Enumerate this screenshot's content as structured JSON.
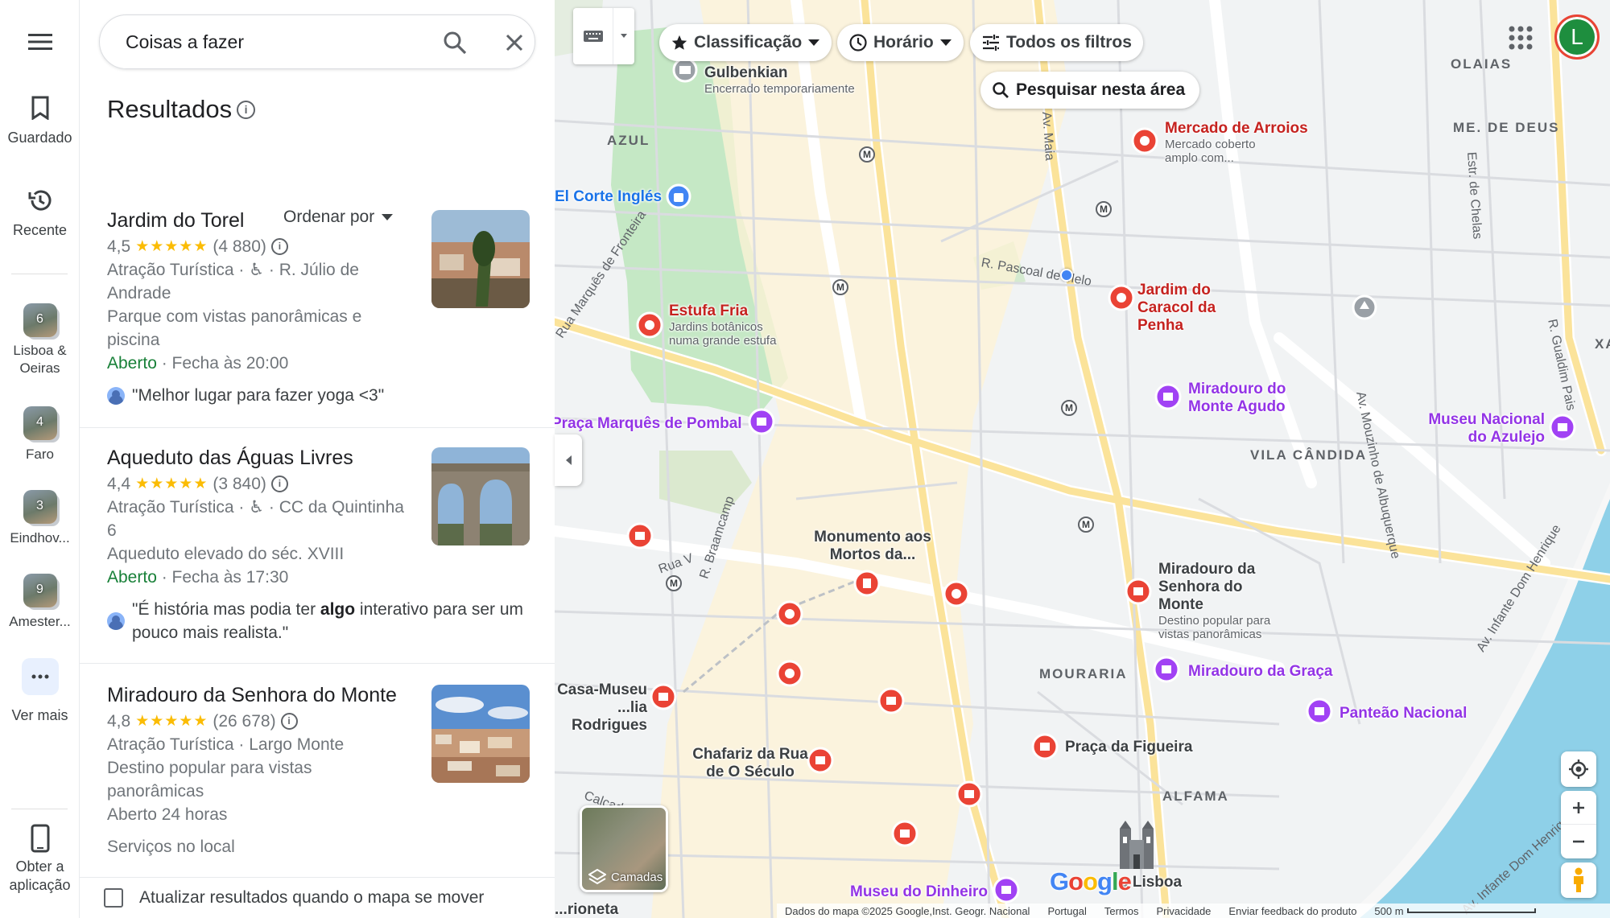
{
  "rail": {
    "saved": "Guardado",
    "recent": "Recente",
    "lists": [
      {
        "count": "6",
        "label": "Lisboa & Oeiras"
      },
      {
        "count": "4",
        "label": "Faro"
      },
      {
        "count": "3",
        "label": "Eindhov..."
      },
      {
        "count": "9",
        "label": "Amester..."
      }
    ],
    "more": "Ver mais",
    "get_app": "Obter a aplicação"
  },
  "search": {
    "value": "Coisas a fazer"
  },
  "results": {
    "title": "Resultados",
    "sort_by": "Ordenar por",
    "items": [
      {
        "name": "Jardim do Torel",
        "rating": "4,5",
        "stars": "★★★★★",
        "reviews": "(4 880)",
        "category": "Atração Turística · ♿ · R. Júlio de Andrade",
        "description": "Parque com vistas panorâmicas e piscina",
        "open": "Aberto",
        "hours": " · Fecha às 20:00",
        "review": "\"Melhor lugar para fazer yoga <3\""
      },
      {
        "name": "Aqueduto das Águas Livres",
        "rating": "4,4",
        "stars": "★★★★★",
        "reviews": "(3 840)",
        "category": "Atração Turística · ♿ · CC da Quintinha 6",
        "description": "Aqueduto elevado do séc. XVIII",
        "open": "Aberto",
        "hours": " · Fecha às 17:30",
        "review_a": "\"É história mas podia ter ",
        "review_b": "algo",
        "review_c": " interativo para ser um pouco mais realista.\""
      },
      {
        "name": "Miradouro da Senhora do Monte",
        "rating": "4,8",
        "stars": "★★★★★",
        "reviews": "(26 678)",
        "category": "Atração Turística · Largo Monte",
        "description": "Destino popular para vistas panorâmicas",
        "open": "Aberto 24 horas",
        "services": "Serviços no local"
      }
    ],
    "update_checkbox": "Atualizar resultados quando o mapa se mover"
  },
  "map": {
    "filters": {
      "rating": "Classificação",
      "hours": "Horário",
      "all_filters": "Todos os filtros"
    },
    "search_area": "Pesquisar nesta área",
    "layers": "Camadas",
    "avatar_letter": "L",
    "google": "Google",
    "pois": [
      {
        "name": "Gulbenkian",
        "sub": "Encerrado temporariamente"
      },
      {
        "name": "Mercado de Arroios",
        "sub": "Mercado coberto amplo com..."
      },
      {
        "name": "El Corte Inglés"
      },
      {
        "name": "Estufa Fria",
        "sub": "Jardins botânicos numa grande estufa"
      },
      {
        "name": "Jardim do Caracol da Penha"
      },
      {
        "name": "Miradouro do Monte Agudo"
      },
      {
        "name": "Museu Nacional do Azulejo"
      },
      {
        "name": "Praça Marquês de Pombal"
      },
      {
        "name": "Monumento aos Mortos da..."
      },
      {
        "name": "Miradouro da Senhora do Monte",
        "sub": "Destino popular para vistas panorâmicas"
      },
      {
        "name": "Miradouro da Graça"
      },
      {
        "name": "Panteão Nacional"
      },
      {
        "name": "Casa-Museu ...lia Rodrigues"
      },
      {
        "name": "Chafariz da Rua de O Século"
      },
      {
        "name": "Praça da Figueira"
      },
      {
        "name": "Museu do Dinheiro"
      },
      {
        "name": "e Lisboa"
      },
      {
        "name": "...rioneta"
      }
    ],
    "areas": {
      "olaias": "OLAIAS",
      "me_deus": "ME. DE DEUS",
      "azul": "AZUL",
      "vila_candida": "VILA CÂNDIDA",
      "mouraria": "MOURARIA",
      "alfama": "ALFAMA",
      "xa": "XA"
    },
    "streets": {
      "pascoal": "R. Pascoal de Melo",
      "braamcamp": "R. Braamcamp",
      "marques_fronteira": "Rua Marquês de Fronteira",
      "mouzinho": "Av. Mouzinho de Albuquerque",
      "infante": "Av. Infante Dom Henrique",
      "infante2": "Av. Infante Dom Henrique",
      "chelas": "Estr. de Chelas",
      "guadalupe": "R. Gualdim Pais",
      "calcada": "Calçada",
      "rua_v": "Rua V",
      "maia": "Av. Maia"
    },
    "footer": {
      "data": "Dados do mapa ©2025 Google,Inst. Geogr. Nacional",
      "country": "Portugal",
      "terms": "Termos",
      "privacy": "Privacidade",
      "feedback": "Enviar feedback do produto",
      "scale": "500 m"
    }
  },
  "colors": {
    "accent_blue": "#1a73e8",
    "open_green": "#188038",
    "star": "#fbbc04",
    "poi_red": "#ea4335",
    "poi_purple": "#a142f4",
    "water": "#8ed0e8",
    "park": "#c5e8c5"
  }
}
